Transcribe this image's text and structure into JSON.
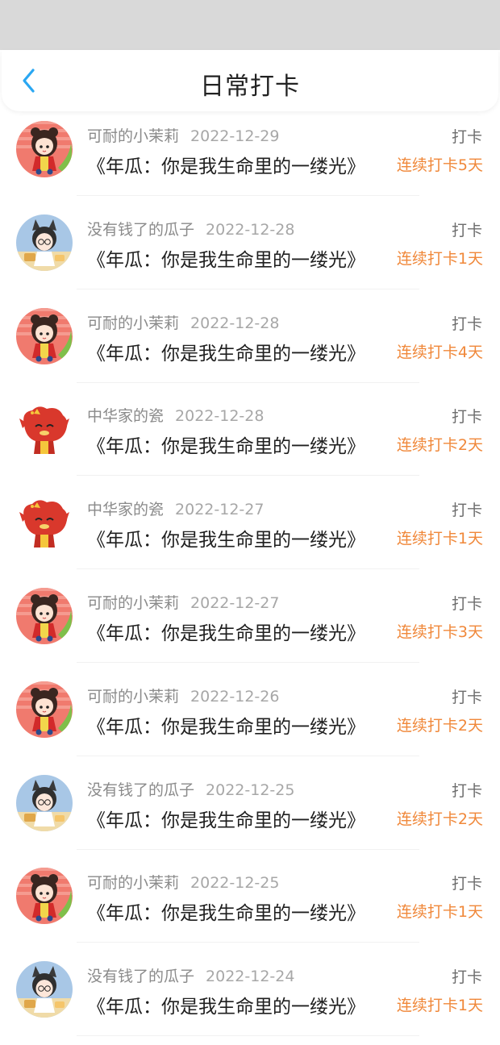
{
  "header": {
    "title": "日常打卡",
    "back_icon": "chevron-left-icon",
    "accent": "#2aa7f2"
  },
  "colors": {
    "streak": "#f0883a",
    "statusbar": "#d9d9d9"
  },
  "records": [
    {
      "user": "可耐的小茉莉",
      "date": "2022-12-29",
      "book": "《年瓜：你是我生命里的一缕光》",
      "action": "打卡",
      "streak": "连续打卡5天",
      "avatar": "girl-avatar"
    },
    {
      "user": "没有钱了的瓜子",
      "date": "2022-12-28",
      "book": "《年瓜：你是我生命里的一缕光》",
      "action": "打卡",
      "streak": "连续打卡1天",
      "avatar": "cat-boy-avatar"
    },
    {
      "user": "可耐的小茉莉",
      "date": "2022-12-28",
      "book": "《年瓜：你是我生命里的一缕光》",
      "action": "打卡",
      "streak": "连续打卡4天",
      "avatar": "girl-avatar"
    },
    {
      "user": "中华家的瓷",
      "date": "2022-12-28",
      "book": "《年瓜：你是我生命里的一缕光》",
      "action": "打卡",
      "streak": "连续打卡2天",
      "avatar": "dragon-avatar"
    },
    {
      "user": "中华家的瓷",
      "date": "2022-12-27",
      "book": "《年瓜：你是我生命里的一缕光》",
      "action": "打卡",
      "streak": "连续打卡1天",
      "avatar": "dragon-avatar"
    },
    {
      "user": "可耐的小茉莉",
      "date": "2022-12-27",
      "book": "《年瓜：你是我生命里的一缕光》",
      "action": "打卡",
      "streak": "连续打卡3天",
      "avatar": "girl-avatar"
    },
    {
      "user": "可耐的小茉莉",
      "date": "2022-12-26",
      "book": "《年瓜：你是我生命里的一缕光》",
      "action": "打卡",
      "streak": "连续打卡2天",
      "avatar": "girl-avatar"
    },
    {
      "user": "没有钱了的瓜子",
      "date": "2022-12-25",
      "book": "《年瓜：你是我生命里的一缕光》",
      "action": "打卡",
      "streak": "连续打卡2天",
      "avatar": "cat-boy-avatar"
    },
    {
      "user": "可耐的小茉莉",
      "date": "2022-12-25",
      "book": "《年瓜：你是我生命里的一缕光》",
      "action": "打卡",
      "streak": "连续打卡1天",
      "avatar": "girl-avatar"
    },
    {
      "user": "没有钱了的瓜子",
      "date": "2022-12-24",
      "book": "《年瓜：你是我生命里的一缕光》",
      "action": "打卡",
      "streak": "连续打卡1天",
      "avatar": "cat-boy-avatar"
    }
  ]
}
